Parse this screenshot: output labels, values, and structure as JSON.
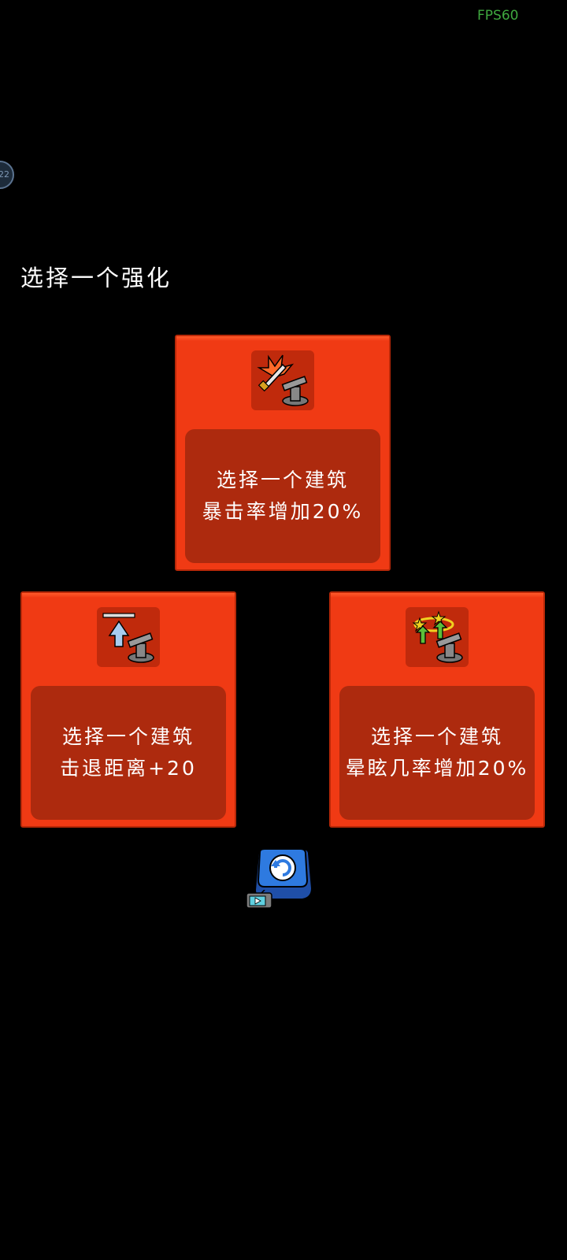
{
  "hud": {
    "fps": "FPS60",
    "badge_text": "22"
  },
  "prompt": "选择一个强化",
  "cards": [
    {
      "line1": "选择一个建筑",
      "line2": "暴击率增加20%",
      "icon": "crit-sword-turret-icon"
    },
    {
      "line1": "选择一个建筑",
      "line2": "击退距离+20",
      "icon": "knockback-arrow-turret-icon"
    },
    {
      "line1": "选择一个建筑",
      "line2": "晕眩几率增加20%",
      "icon": "stun-stars-turret-icon"
    }
  ],
  "refresh_button": {
    "icon": "refresh-icon",
    "ad_icon": "video-ad-icon"
  },
  "colors": {
    "card_bg": "#f03a14",
    "card_inner": "#ad2a0e",
    "fps": "#3fa83f",
    "refresh": "#2e6bd6"
  }
}
